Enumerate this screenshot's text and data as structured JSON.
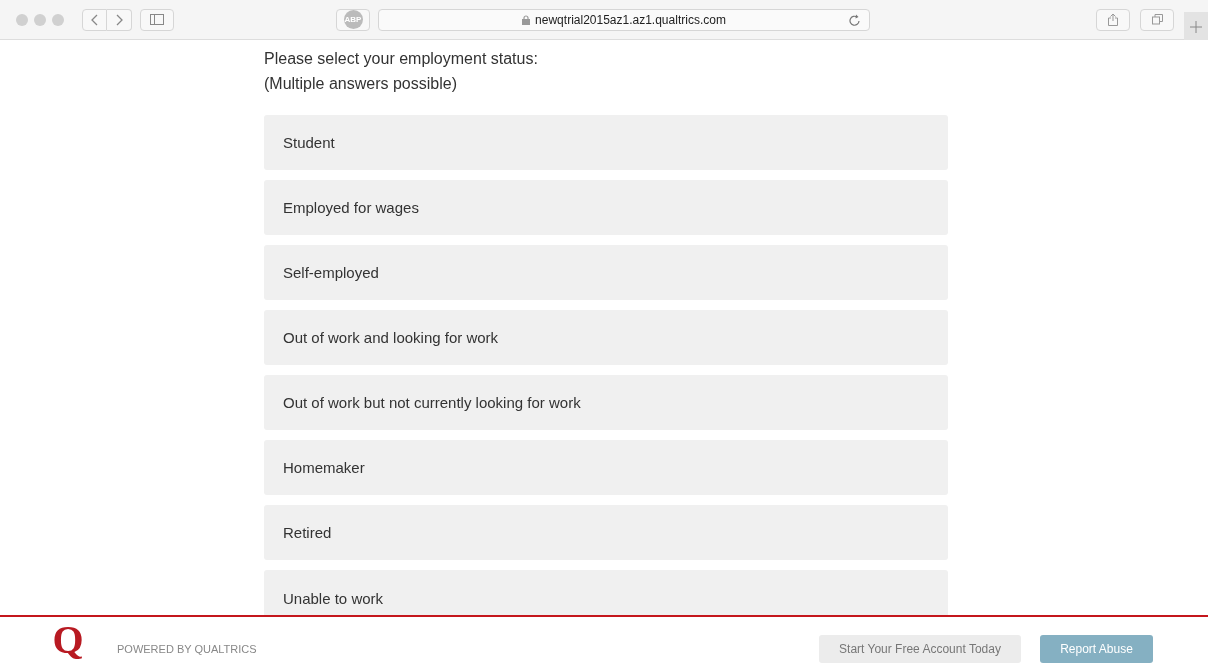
{
  "browser": {
    "adblock_label": "ABP",
    "url": "newqtrial2015az1.az1.qualtrics.com"
  },
  "question": {
    "text": "Please select your employment status:",
    "note": "(Multiple answers possible)"
  },
  "options": [
    {
      "label": "Student",
      "selected": false
    },
    {
      "label": "Employed for wages",
      "selected": false
    },
    {
      "label": "Self-employed",
      "selected": false
    },
    {
      "label": "Out of work and looking for work",
      "selected": false
    },
    {
      "label": "Out of work but not currently looking for work",
      "selected": false
    },
    {
      "label": "Homemaker",
      "selected": false
    },
    {
      "label": "Retired",
      "selected": false
    },
    {
      "label": "Unable to work",
      "selected": false
    }
  ],
  "footer": {
    "logo": "Q",
    "powered_by": "POWERED BY QUALTRICS",
    "buttons": [
      "Start Your Free Account Today",
      "Report Abuse"
    ]
  }
}
